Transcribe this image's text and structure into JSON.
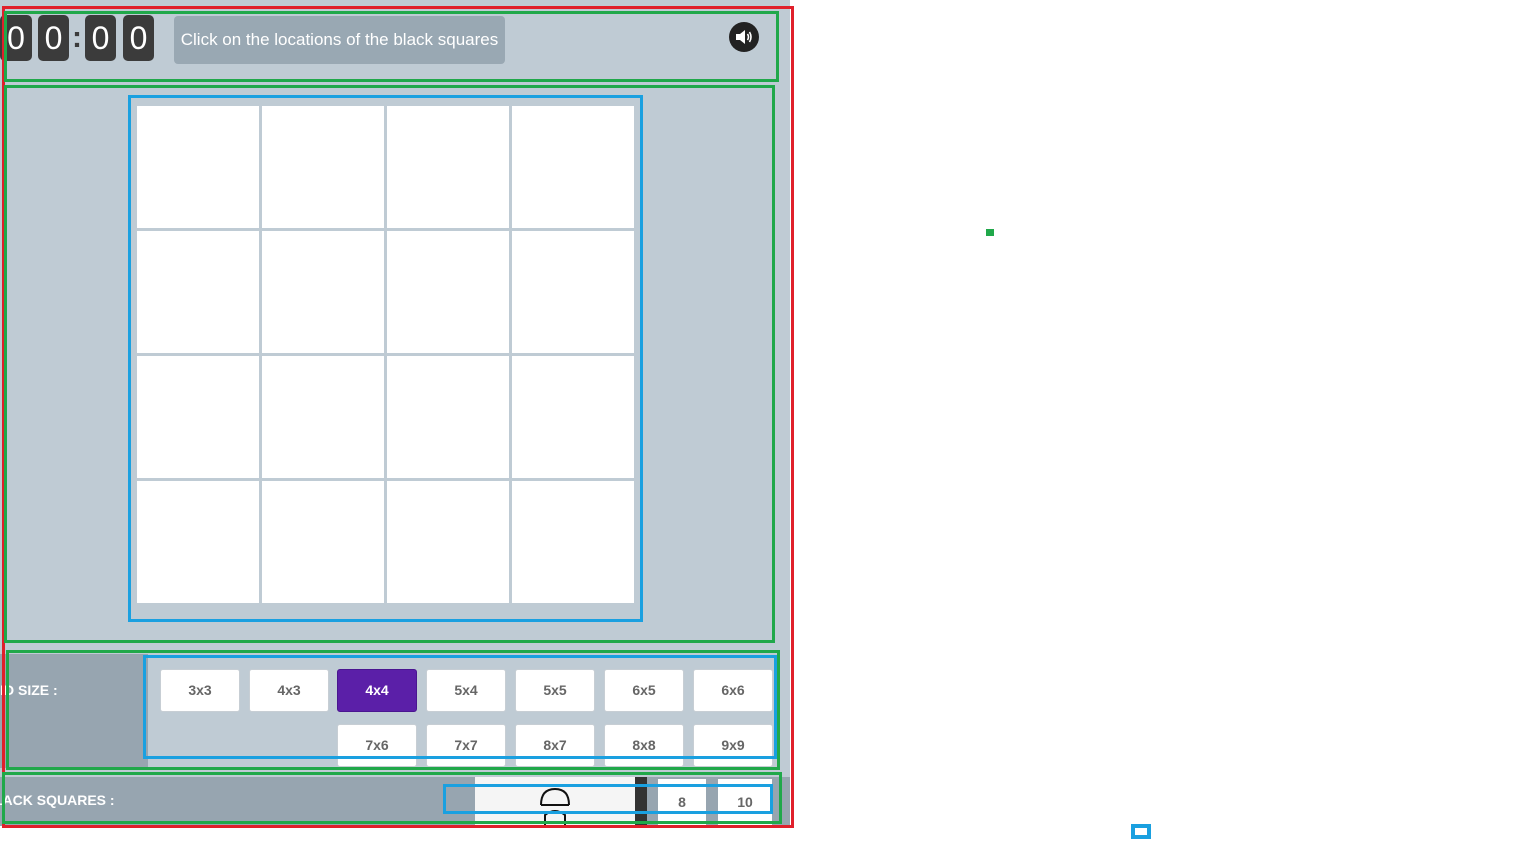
{
  "timer": {
    "d1": "0",
    "d2": "0",
    "sep": ":",
    "d3": "0",
    "d4": "0"
  },
  "instruction": "Click on the locations of the black squares",
  "grid": {
    "rows": 4,
    "cols": 4
  },
  "grid_size": {
    "label": "RID SIZE :",
    "options": [
      "3x3",
      "4x3",
      "4x4",
      "5x4",
      "5x5",
      "6x5",
      "6x6",
      "7x6",
      "7x7",
      "8x7",
      "8x8",
      "9x9"
    ],
    "selected": "4x4"
  },
  "black_squares": {
    "label": "LACK SQUARES :",
    "options": [
      "8",
      "10"
    ]
  },
  "colors": {
    "selected": "#5b1fa8",
    "panel": "#bfcbd4",
    "label_bg": "#97a5b0"
  }
}
